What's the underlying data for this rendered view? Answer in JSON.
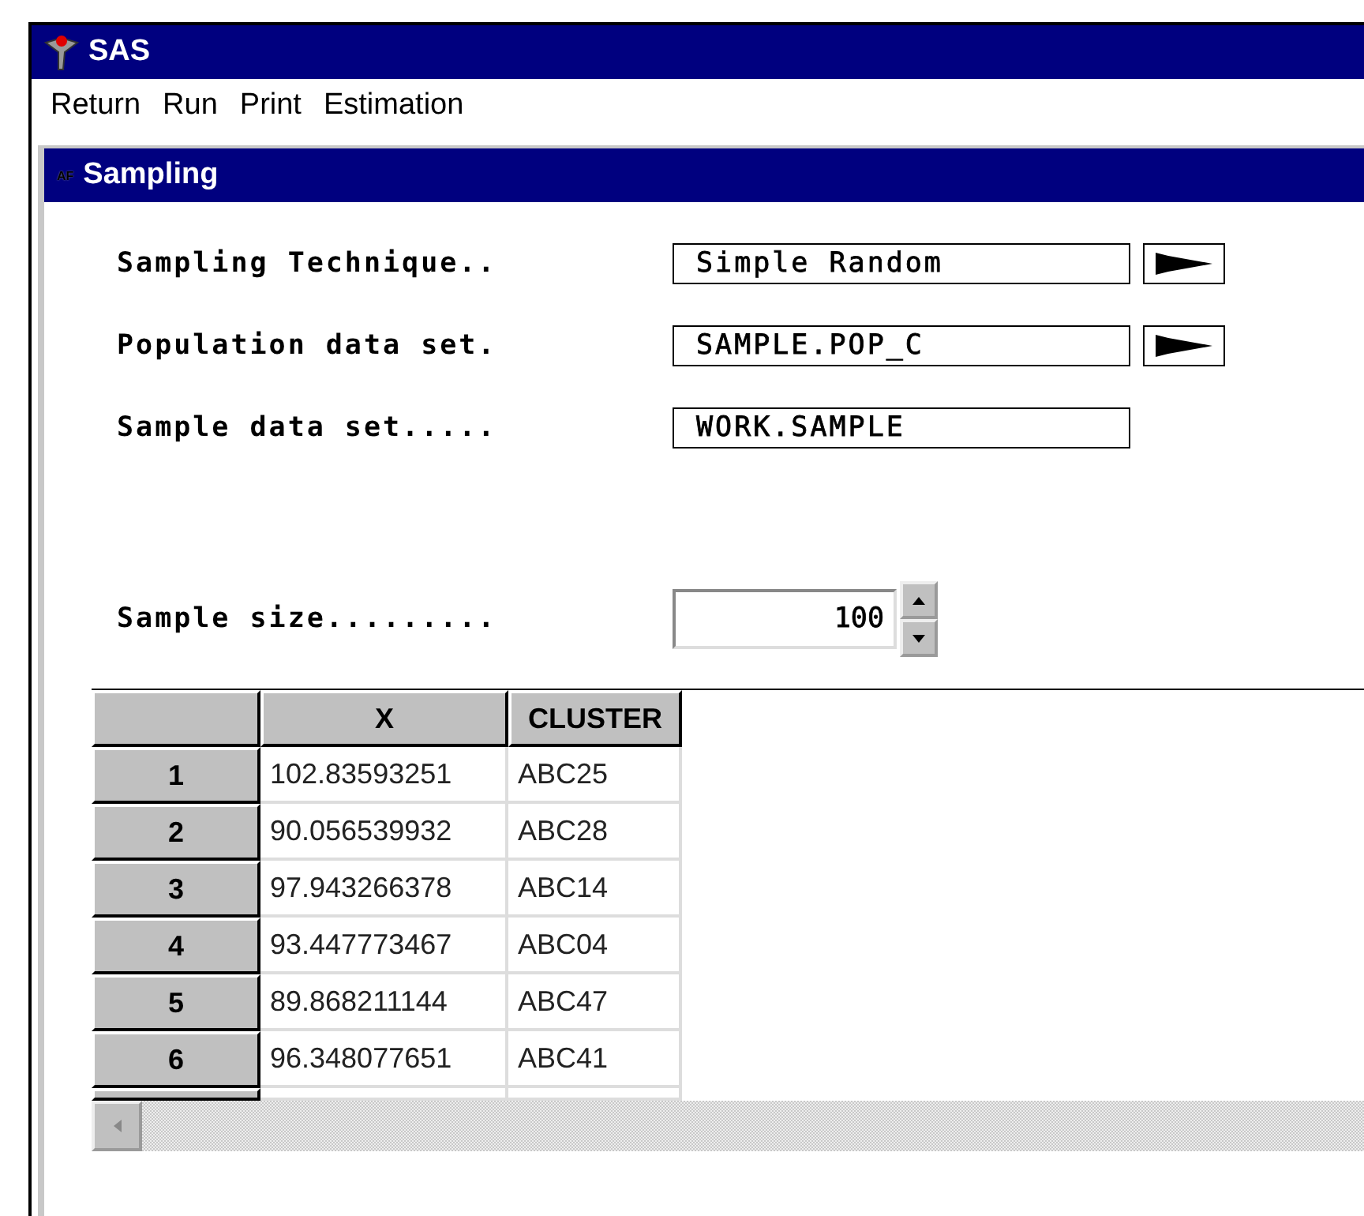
{
  "window": {
    "title": "SAS"
  },
  "menu": [
    {
      "label": "Return"
    },
    {
      "label": "Run"
    },
    {
      "label": "Print"
    },
    {
      "label": "Estimation"
    }
  ],
  "dialog": {
    "badge": "AF",
    "title": "Sampling"
  },
  "fields": [
    {
      "kind": "list",
      "label": "Sampling Technique..",
      "value": "Simple Random"
    },
    {
      "kind": "list",
      "label": "Population data set.",
      "value": "SAMPLE.POP_C"
    },
    {
      "kind": "text",
      "label": "Sample data set.....",
      "value": "WORK.SAMPLE"
    }
  ],
  "spinner": {
    "label": "Sample size.........",
    "value": "100"
  },
  "table": {
    "columns": [
      "X",
      "CLUSTER"
    ],
    "rows": [
      {
        "header": "1",
        "cells": [
          "102.83593251",
          "ABC25"
        ]
      },
      {
        "header": "2",
        "cells": [
          "90.056539932",
          "ABC28"
        ]
      },
      {
        "header": "3",
        "cells": [
          "97.943266378",
          "ABC14"
        ]
      },
      {
        "header": "4",
        "cells": [
          "93.447773467",
          "ABC04"
        ]
      },
      {
        "header": "5",
        "cells": [
          "89.868211144",
          "ABC47"
        ]
      },
      {
        "header": "6",
        "cells": [
          "96.348077651",
          "ABC41"
        ]
      }
    ]
  }
}
